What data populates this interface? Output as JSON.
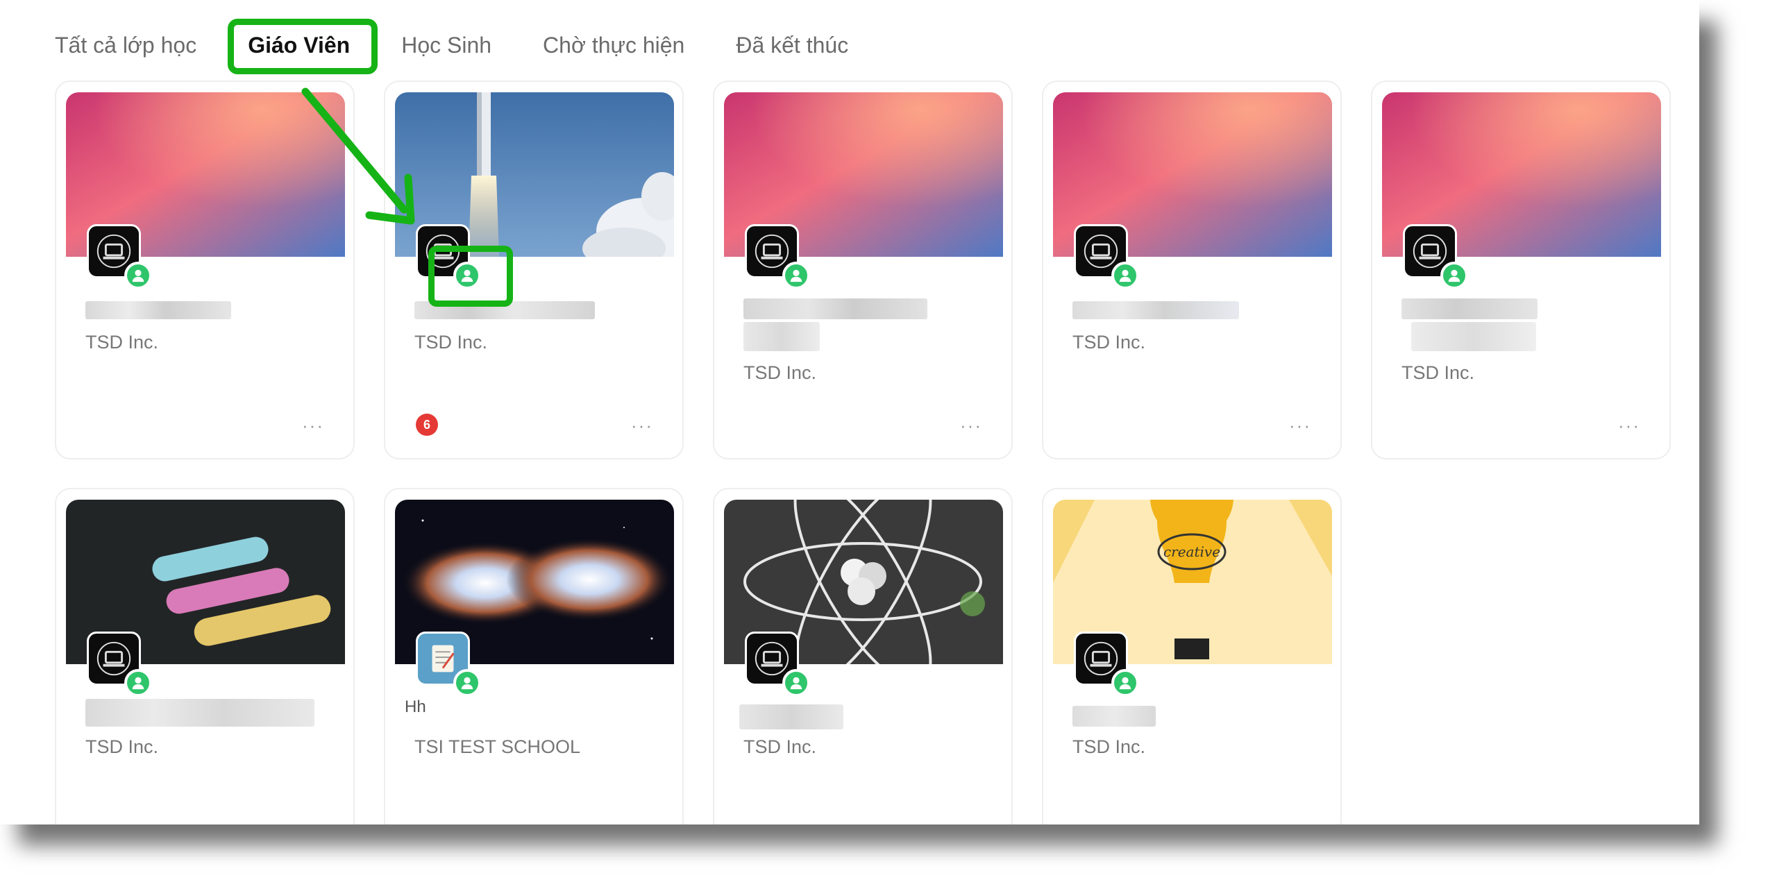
{
  "tabs": [
    {
      "label": "Tất cả lớp học",
      "active": false
    },
    {
      "label": "Giáo Viên",
      "active": true
    },
    {
      "label": "Học Sinh",
      "active": false
    },
    {
      "label": "Chờ thực hiện",
      "active": false
    },
    {
      "label": "Đã kết thúc",
      "active": false
    }
  ],
  "cards": [
    {
      "cover": "gradient",
      "org": "TSD Inc.",
      "more": "···",
      "role_icon": "teacher-icon"
    },
    {
      "cover": "rocket",
      "org": "TSD Inc.",
      "more": "···",
      "role_icon": "teacher-icon",
      "notification_count": "6"
    },
    {
      "cover": "gradient",
      "org": "TSD Inc.",
      "more": "···",
      "role_icon": "teacher-icon"
    },
    {
      "cover": "gradient",
      "org": "TSD Inc.",
      "more": "···",
      "role_icon": "teacher-icon"
    },
    {
      "cover": "gradient",
      "org": "TSD Inc.",
      "more": "···",
      "role_icon": "teacher-icon"
    },
    {
      "cover": "chalk",
      "org": "TSD Inc.",
      "role_icon": "teacher-icon"
    },
    {
      "cover": "nebula",
      "org": "TSI TEST SCHOOL",
      "role_icon": "teacher-icon",
      "name_fragment": "Hh"
    },
    {
      "cover": "atom",
      "org": "TSD Inc.",
      "role_icon": "teacher-icon"
    },
    {
      "cover": "lightbulb",
      "org": "TSD Inc.",
      "role_icon": "teacher-icon",
      "cover_text": "creative"
    }
  ],
  "colors": {
    "highlight": "#16b316",
    "teacher_badge": "#2fc56b",
    "notification": "#e53935"
  }
}
